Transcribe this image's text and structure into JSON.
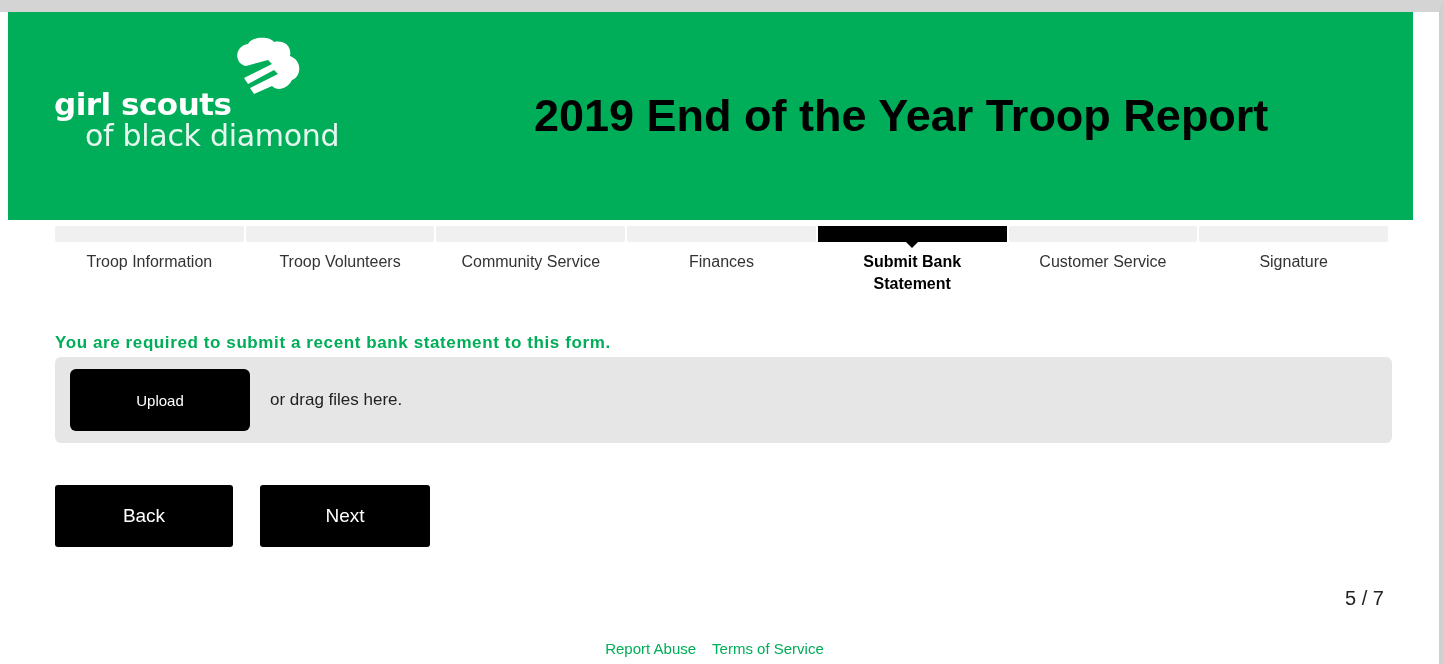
{
  "header": {
    "logo_line_1": "girl scouts",
    "logo_line_2": "of black diamond",
    "title": "2019 End of the Year Troop Report"
  },
  "steps": [
    {
      "label": "Troop Information",
      "selected": false
    },
    {
      "label": "Troop Volunteers",
      "selected": false
    },
    {
      "label": "Community Service",
      "selected": false
    },
    {
      "label": "Finances",
      "selected": false
    },
    {
      "label": "Submit Bank Statement",
      "selected": true
    },
    {
      "label": "Customer Service",
      "selected": false
    },
    {
      "label": "Signature",
      "selected": false
    }
  ],
  "upload": {
    "instruction": "You are required to submit a recent bank statement to this form.",
    "button": "Upload",
    "hint": "or drag files here."
  },
  "buttons": [
    "Back",
    "Next"
  ],
  "page_indicator": "5 / 7",
  "footer_links": [
    "Report Abuse",
    "Terms of Service"
  ]
}
